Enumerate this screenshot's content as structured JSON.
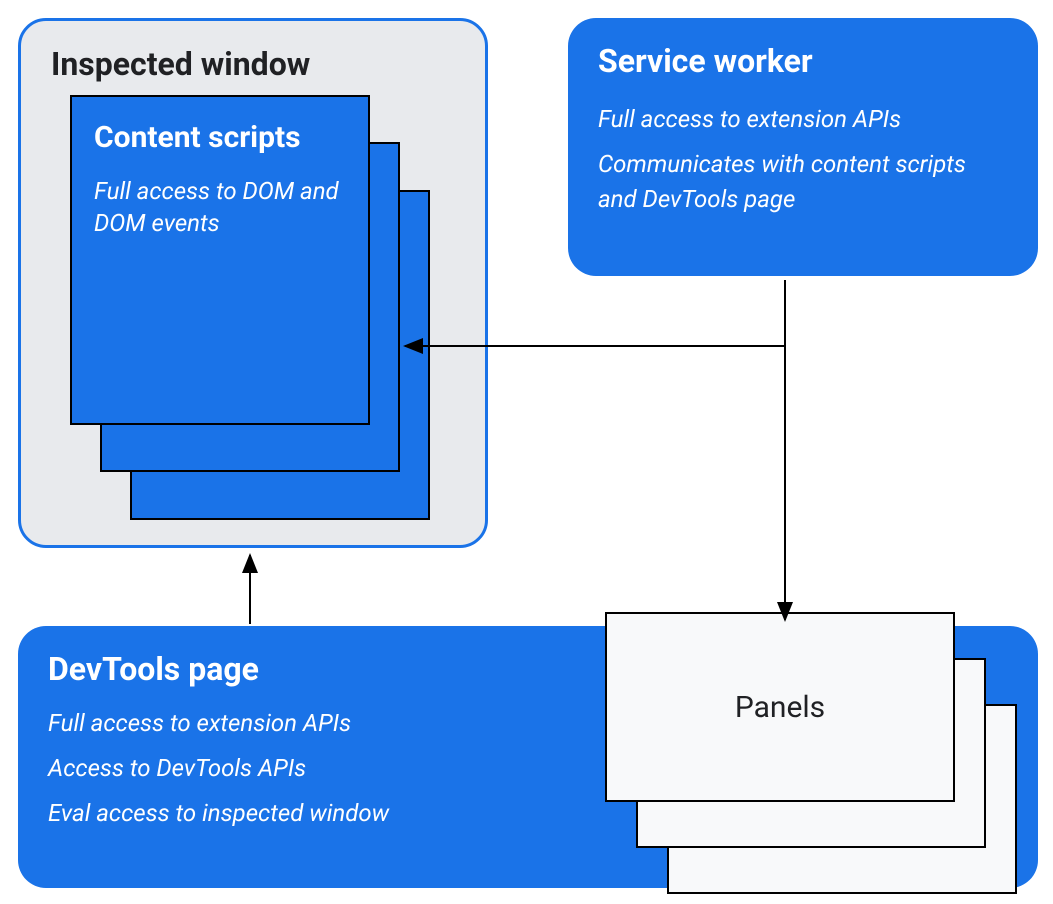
{
  "inspected_window": {
    "title": "Inspected window",
    "content_scripts": {
      "title": "Content scripts",
      "desc": "Full access to DOM and DOM events"
    }
  },
  "service_worker": {
    "title": "Service worker",
    "desc1": "Full access to extension APIs",
    "desc2": "Communicates with content scripts and DevTools page"
  },
  "devtools_page": {
    "title": "DevTools page",
    "desc1": "Full access to extension APIs",
    "desc2": "Access to DevTools APIs",
    "desc3": "Eval access to inspected window",
    "panels_label": "Panels"
  }
}
